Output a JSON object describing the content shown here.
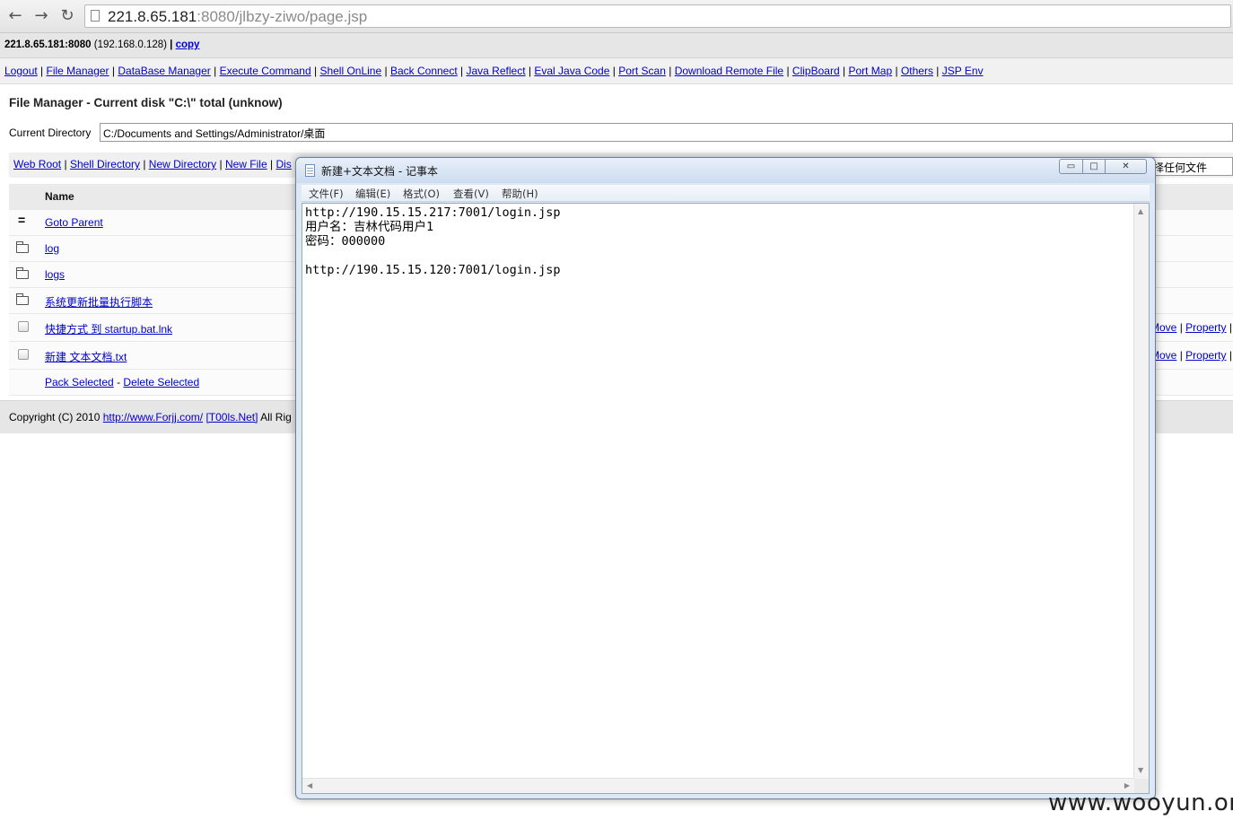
{
  "browser": {
    "back_icon": "arrow-left",
    "forward_icon": "arrow-right",
    "reload_icon": "reload",
    "url_host": "221.8.65.181",
    "url_rest": ":8080/jlbzy-ziwo/page.jsp"
  },
  "host": {
    "address": "221.8.65.181:8080",
    "local_ip": "(192.168.0.128)",
    "separator": "|",
    "copy_label": "copy"
  },
  "nav": {
    "items": [
      "Logout",
      "File Manager",
      "DataBase Manager",
      "Execute Command",
      "Shell OnLine",
      "Back Connect",
      "Java Reflect",
      "Eval Java Code",
      "Port Scan",
      "Download Remote File",
      "ClipBoard",
      "Port Map",
      "Others",
      "JSP Env"
    ],
    "separator": "|"
  },
  "file_manager": {
    "title": "File Manager - Current disk \"C:\\\" total (unknow)",
    "current_dir_label": "Current Directory",
    "current_dir_value": "C:/Documents and Settings/Administrator/桌面",
    "toolbar": {
      "web_root": "Web Root",
      "shell_directory": "Shell Directory",
      "new_directory": "New Directory",
      "new_file": "New File",
      "partial_item": "Dis",
      "separator": "|",
      "input_visible_text": "择任何文件"
    },
    "column_name": "Name",
    "goto_parent_symbol": "=",
    "goto_parent": "Goto Parent",
    "rows": [
      {
        "name": "log",
        "type": "folder"
      },
      {
        "name": "logs",
        "type": "folder"
      },
      {
        "name": "系统更新批量执行脚本",
        "type": "folder"
      }
    ],
    "files": [
      {
        "name": "快捷方式 到 startup.bat.lnk",
        "move": "Move",
        "property": "Property"
      },
      {
        "name": "新建 文本文档.txt",
        "move": "Move",
        "property": "Property"
      }
    ],
    "pack_selected": "Pack Selected",
    "dash": "-",
    "delete_selected": "Delete Selected"
  },
  "footer": {
    "text_prefix": "Copyright (C) 2010",
    "link1": "http://www.Forjj.com/",
    "link2": "[T00ls.Net]",
    "text_suffix": "All Rig"
  },
  "notepad": {
    "title": "新建+文本文档 - 记事本",
    "min_glyph": "▭",
    "max_glyph": "□",
    "close_glyph": "✕",
    "menus": [
      "文件(F)",
      "编辑(E)",
      "格式(O)",
      "查看(V)",
      "帮助(H)"
    ],
    "content": "http://190.15.15.217:7001/login.jsp\n用户名：吉林代码用户1\n密码：000000\n\nhttp://190.15.15.120:7001/login.jsp"
  },
  "watermark": "www.wooyun.org"
}
